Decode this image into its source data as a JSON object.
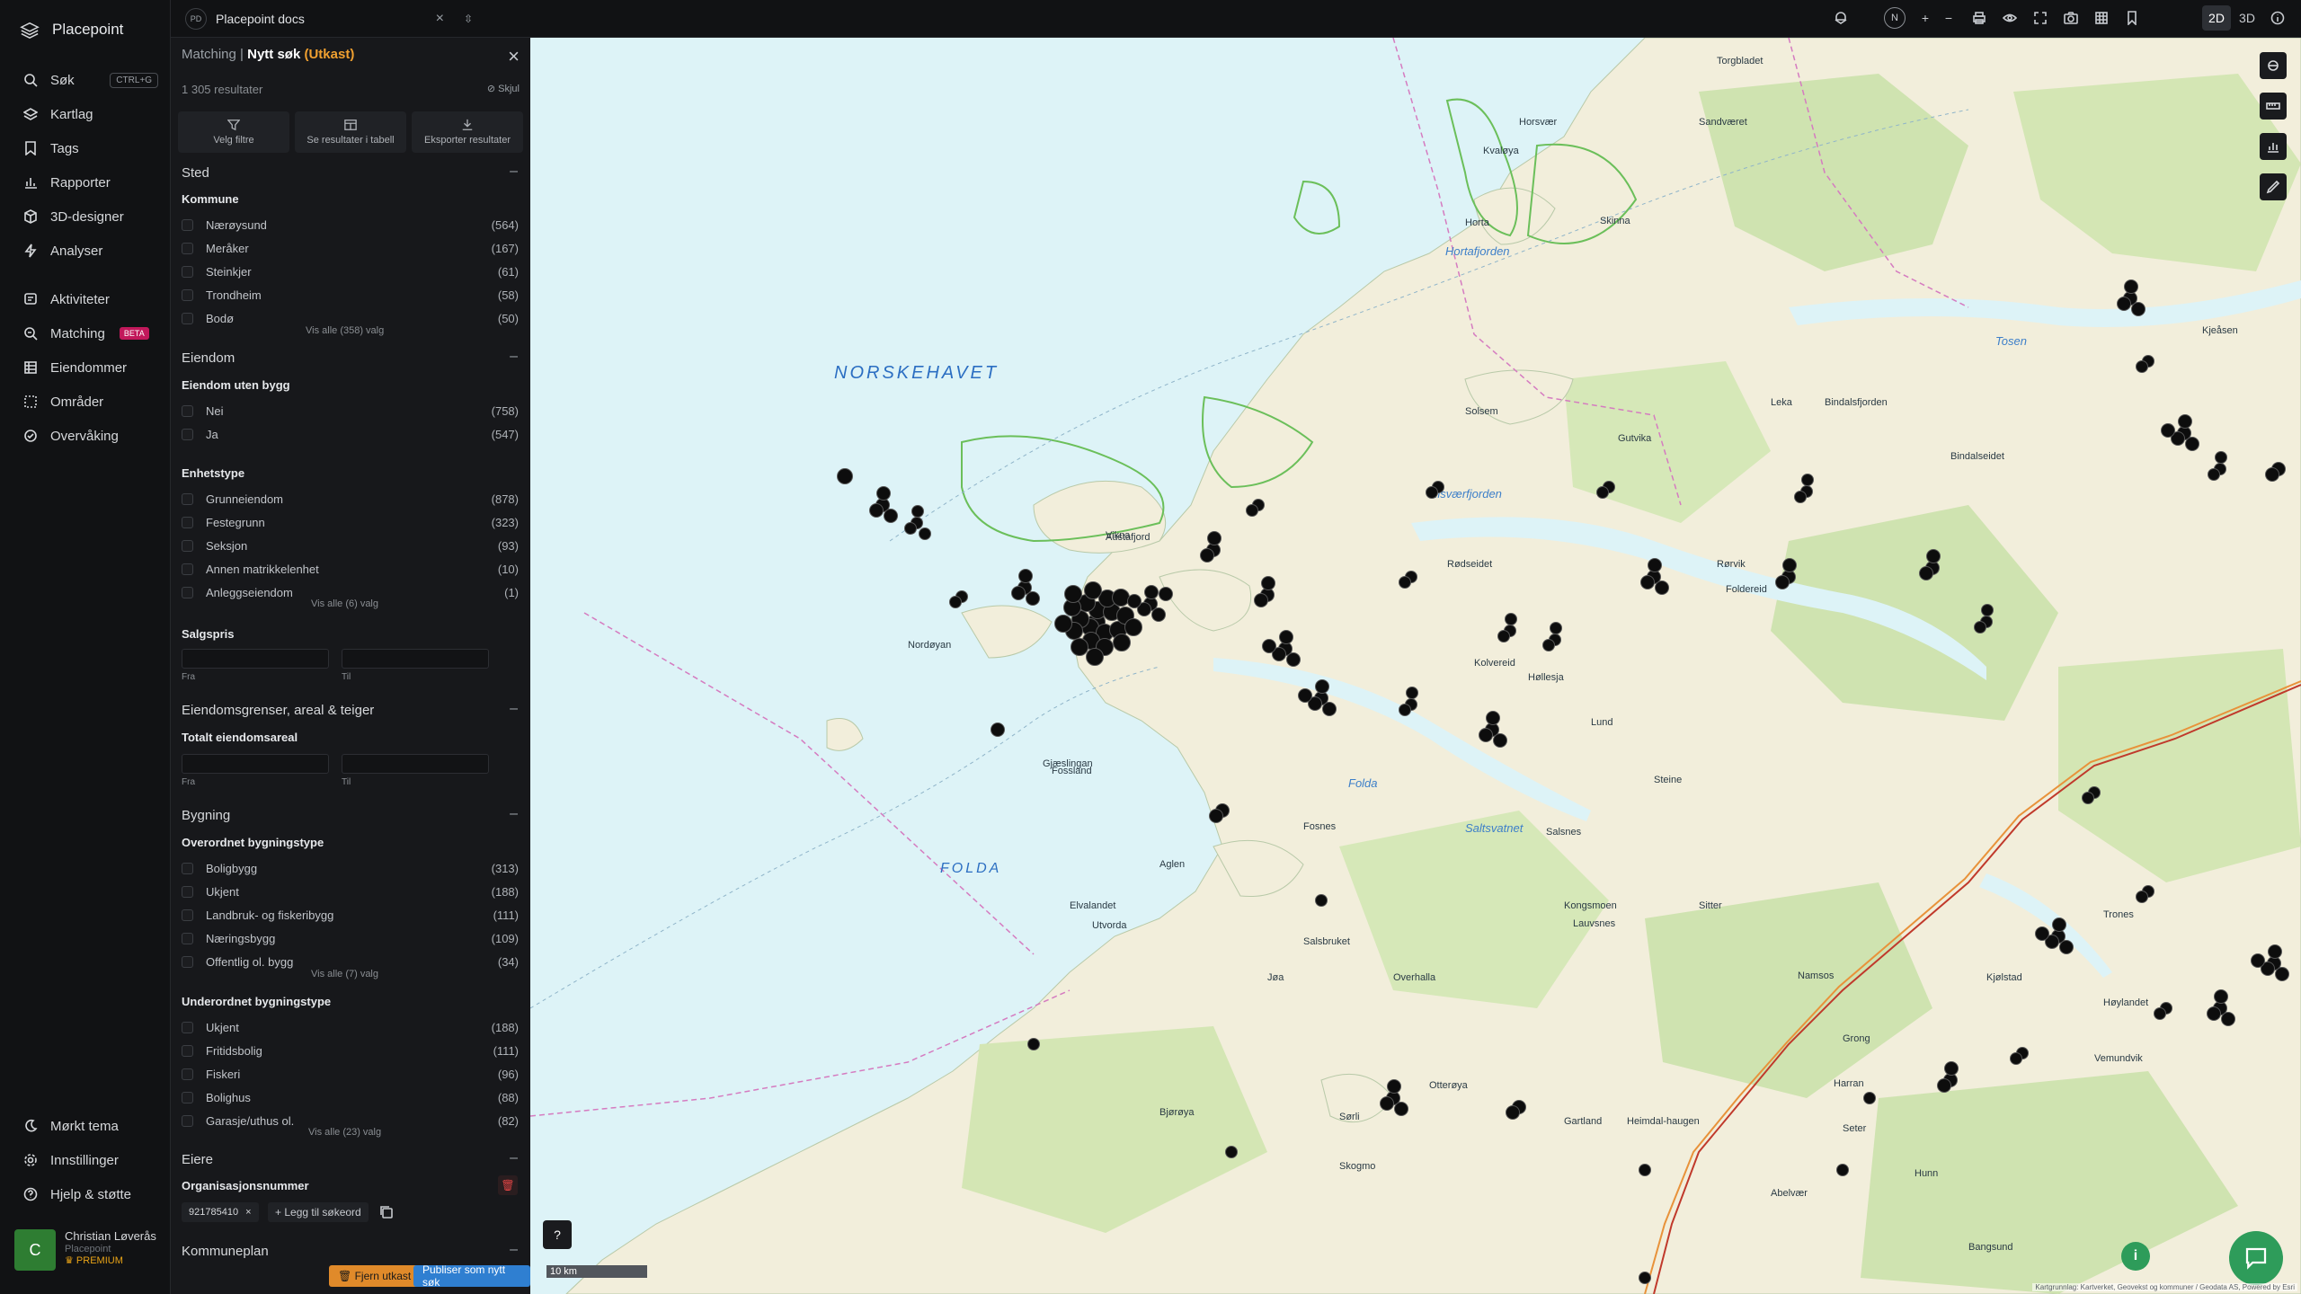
{
  "app": {
    "name": "Placepoint"
  },
  "nav": {
    "items": [
      {
        "label": "Søk",
        "shortcut": "CTRL+G"
      },
      {
        "label": "Kartlag"
      },
      {
        "label": "Tags"
      },
      {
        "label": "Rapporter"
      },
      {
        "label": "3D-designer"
      },
      {
        "label": "Analyser"
      },
      {
        "label": "Aktiviteter"
      },
      {
        "label": "Matching",
        "badge": "BETA"
      },
      {
        "label": "Eiendommer"
      },
      {
        "label": "Områder"
      },
      {
        "label": "Overvåking"
      }
    ],
    "bottom": [
      {
        "label": "Mørkt tema"
      },
      {
        "label": "Innstillinger"
      },
      {
        "label": "Hjelp & støtte"
      }
    ],
    "user": {
      "initial": "C",
      "name": "Christian Løverås",
      "org": "Placepoint",
      "plan": "PREMIUM"
    }
  },
  "topbar": {
    "doc_badge": "PD",
    "doc_name": "Placepoint docs",
    "compass": "N",
    "mode_2d": "2D",
    "mode_3d": "3D",
    "active_mode": "2D"
  },
  "panel": {
    "breadcrumb_parent": "Matching",
    "separator": "|",
    "title": "Nytt søk",
    "draft": "(Utkast)",
    "result_count": "1 305 resultater",
    "hide_label": "Skjul",
    "actions": [
      "Velg filtre",
      "Se resultater i tabell",
      "Eksporter resultater"
    ],
    "sections": {
      "sted": {
        "title": "Sted",
        "kommune": {
          "label": "Kommune",
          "options": [
            {
              "name": "Nærøysund",
              "count": "(564)"
            },
            {
              "name": "Meråker",
              "count": "(167)"
            },
            {
              "name": "Steinkjer",
              "count": "(61)"
            },
            {
              "name": "Trondheim",
              "count": "(58)"
            },
            {
              "name": "Bodø",
              "count": "(50)"
            }
          ],
          "more": "Vis alle (358) valg"
        }
      },
      "eiendom": {
        "title": "Eiendom",
        "uten_bygg": {
          "label": "Eiendom uten bygg",
          "options": [
            {
              "name": "Nei",
              "count": "(758)"
            },
            {
              "name": "Ja",
              "count": "(547)"
            }
          ]
        },
        "enhetstype": {
          "label": "Enhetstype",
          "options": [
            {
              "name": "Grunneiendom",
              "count": "(878)"
            },
            {
              "name": "Festegrunn",
              "count": "(323)"
            },
            {
              "name": "Seksjon",
              "count": "(93)"
            },
            {
              "name": "Annen matrikkelenhet",
              "count": "(10)"
            },
            {
              "name": "Anleggseiendom",
              "count": "(1)"
            }
          ],
          "more": "Vis alle (6) valg"
        },
        "salgspris": {
          "label": "Salgspris",
          "from": "Fra",
          "to": "Til"
        }
      },
      "areal": {
        "title": "Eiendomsgrenser, areal & teiger",
        "totalt": {
          "label": "Totalt eiendomsareal",
          "from": "Fra",
          "to": "Til"
        }
      },
      "bygning": {
        "title": "Bygning",
        "overordnet": {
          "label": "Overordnet bygningstype",
          "options": [
            {
              "name": "Boligbygg",
              "count": "(313)"
            },
            {
              "name": "Ukjent",
              "count": "(188)"
            },
            {
              "name": "Landbruk- og fiskeribygg",
              "count": "(111)"
            },
            {
              "name": "Næringsbygg",
              "count": "(109)"
            },
            {
              "name": "Offentlig ol. bygg",
              "count": "(34)"
            }
          ],
          "more": "Vis alle (7) valg"
        },
        "underordnet": {
          "label": "Underordnet bygningstype",
          "options": [
            {
              "name": "Ukjent",
              "count": "(188)"
            },
            {
              "name": "Fritidsbolig",
              "count": "(111)"
            },
            {
              "name": "Fiskeri",
              "count": "(96)"
            },
            {
              "name": "Bolighus",
              "count": "(88)"
            },
            {
              "name": "Garasje/uthus ol.",
              "count": "(82)"
            }
          ],
          "more": "Vis alle (23) valg"
        }
      },
      "eiere": {
        "title": "Eiere",
        "org": {
          "label": "Organisasjonsnummer",
          "tag": "921785410",
          "add": "Legg til søkeord"
        }
      },
      "kommuneplan": {
        "title": "Kommuneplan"
      }
    },
    "footer": {
      "remove": "Fjern utkast",
      "publish": "Publiser som nytt søk"
    }
  },
  "map": {
    "sea_labels": [
      "NORSKEHAVET",
      "FOLDA"
    ],
    "fjord_labels": [
      "Hortafjorden",
      "Folda",
      "Saltsvatnet",
      "Risværfjorden",
      "Tosen"
    ],
    "places": [
      "Torgbladet",
      "Horsvær",
      "Sandværet",
      "Skinna",
      "Horta",
      "Kjeåsen",
      "Kvaløya",
      "Leka",
      "Solsem",
      "Gutvika",
      "Bindalsfjorden",
      "Bindalseidet",
      "Rørvik",
      "Nordøyan",
      "Gjæslingan",
      "Salsnes",
      "Fosnes",
      "Vikna",
      "Austafjord",
      "Steine",
      "Rødseidet",
      "Kolvereid",
      "Høllesja",
      "Lund",
      "Aglen",
      "Utvorda",
      "Foldereid",
      "Kjølstad",
      "Trones",
      "Sørli",
      "Namsos",
      "Høylandet",
      "Grong",
      "Harran",
      "Gartland",
      "Salsbruket",
      "Skogmo",
      "Jøa",
      "Otterøya",
      "Seter",
      "Bangsund",
      "Vemundvik",
      "Hunn",
      "Overhalla",
      "Kongsmoen",
      "Heimdal-haugen",
      "Lauvsnes",
      "Elvalandet",
      "Fossland",
      "Bjørøya",
      "Abelvær",
      "Sitter"
    ],
    "scale": "10 km",
    "attribution": "Kartgrunnlag: Kartverket, Geovekst og kommuner / Geodata AS, Powered by Esri",
    "marker_count": 1305
  }
}
